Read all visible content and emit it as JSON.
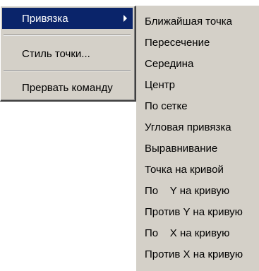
{
  "context_menu": {
    "items": [
      {
        "label": "Привязка",
        "has_submenu": true,
        "highlighted": true
      },
      {
        "label": "Стиль точки..."
      },
      {
        "label": "Прервать команду"
      }
    ]
  },
  "snap_submenu": {
    "items": [
      {
        "label": "Ближайшая точка"
      },
      {
        "label": "Пересечение"
      },
      {
        "label": "Середина"
      },
      {
        "label": "Центр"
      },
      {
        "label": "По сетке"
      },
      {
        "label": "Угловая привязка"
      },
      {
        "label": "Выравнивание"
      },
      {
        "label": "Точка на кривой"
      },
      {
        "label": "По    Y на кривую"
      },
      {
        "label": "Против Y на кривую"
      },
      {
        "label": "По    X на кривую"
      },
      {
        "label": "Против X на кривую"
      }
    ]
  },
  "colors": {
    "menu_background": "#d4d0c8",
    "highlight": "#0a246a",
    "highlight_text": "#ffffff",
    "text": "#000000"
  }
}
